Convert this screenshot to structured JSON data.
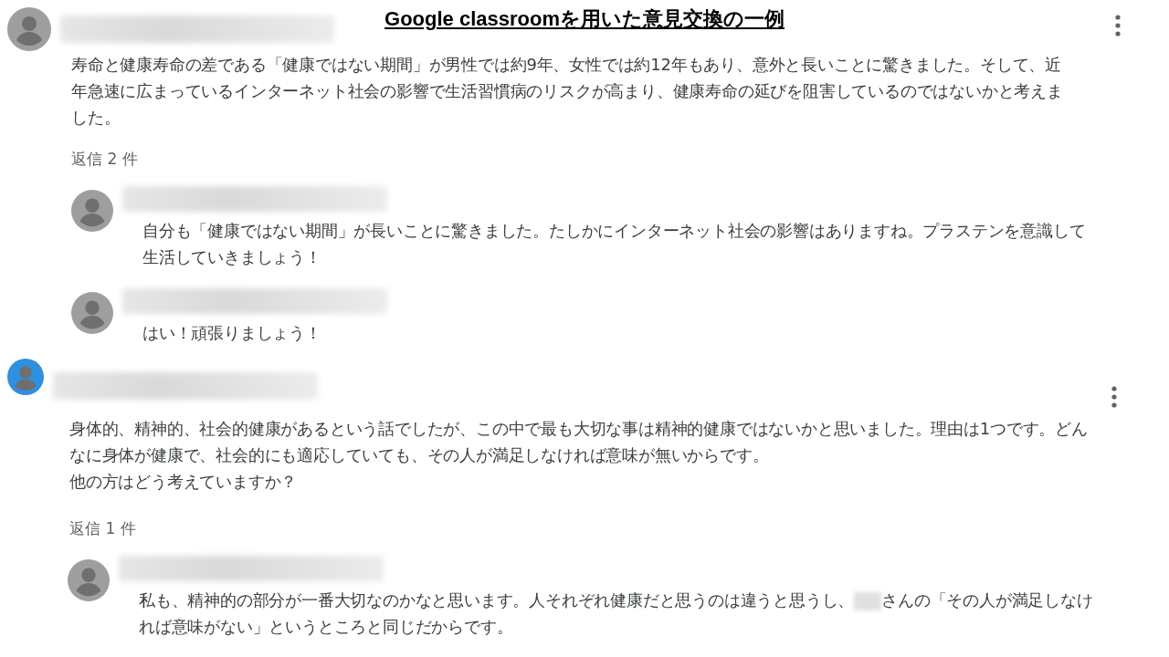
{
  "title": "Google classroomを用いた意見交換の一例",
  "comments": [
    {
      "color": "#9e9e9e",
      "paragraphs": [
        [
          "寿命と健康寿命の差である「健康ではない期間」が男性では約9年、女性では約12年もあり、意外と長いことに驚きました。そして、近年急速に広まっているインターネット社会の影響で生活習慣病のリスクが高まり、健康寿命の延びを阻害しているのではないかと考えました。"
        ]
      ],
      "reply_count": "返信 2 件",
      "replies": [
        {
          "paragraphs": [
            [
              "自分も「健康ではない期間」が長いことに驚きました。たしかにインターネット社会の影響はありますね。プラステンを意識して生活していきましょう！"
            ]
          ]
        },
        {
          "paragraphs": [
            [
              "はい！頑張りましょう！"
            ]
          ]
        }
      ]
    },
    {
      "color": "#2f8fe0",
      "paragraphs": [
        [
          "身体的、精神的、社会的健康があるという話でしたが、この中で最も大切な事は精神的健康ではないかと思いました。理由は1つです。どんなに身体が健康で、社会的にも適応していても、その人が満足しなければ意味が無いからです。"
        ],
        [
          "他の方はどう考えていますか？"
        ]
      ],
      "reply_count": "返信 1 件",
      "replies": [
        {
          "paragraphs": [
            [
              "私も、精神的の部分が一番大切なのかなと思います。人それぞれ健康だと思うのは違うと思うし、",
              "さんの「その人が満足しなければ意味がない」というところと同じだからです。"
            ]
          ]
        }
      ]
    }
  ]
}
